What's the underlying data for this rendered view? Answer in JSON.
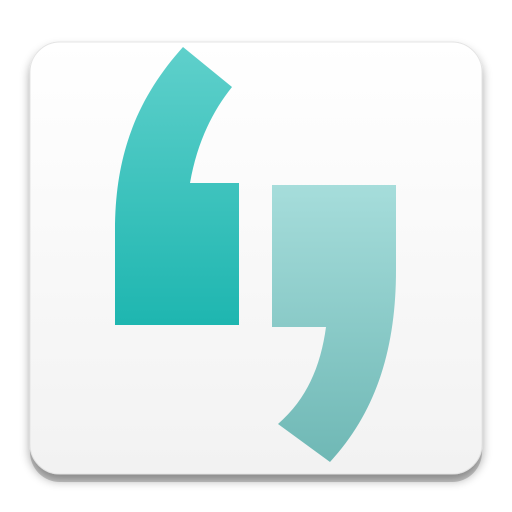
{
  "icon": {
    "name": "quote-marks-app-icon",
    "tile_color_top": "#ffffff",
    "tile_color_bottom": "#f2f2f2",
    "tile_edge_color": "#cfcfcf",
    "left_mark_color_top": "#5fd0cb",
    "left_mark_color_bottom": "#1eb6b0",
    "right_mark_color_top": "#a6dddb",
    "right_mark_color_bottom": "#6fb8b5"
  }
}
